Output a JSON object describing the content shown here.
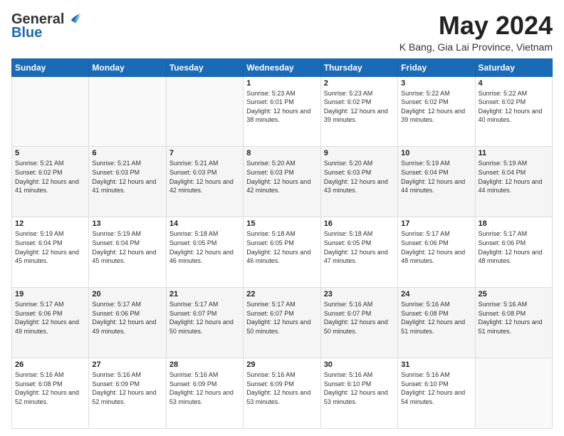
{
  "header": {
    "logo_line1": "General",
    "logo_line2": "Blue",
    "month": "May 2024",
    "location": "K Bang, Gia Lai Province, Vietnam"
  },
  "weekdays": [
    "Sunday",
    "Monday",
    "Tuesday",
    "Wednesday",
    "Thursday",
    "Friday",
    "Saturday"
  ],
  "weeks": [
    [
      {
        "day": "",
        "sunrise": "",
        "sunset": "",
        "daylight": ""
      },
      {
        "day": "",
        "sunrise": "",
        "sunset": "",
        "daylight": ""
      },
      {
        "day": "",
        "sunrise": "",
        "sunset": "",
        "daylight": ""
      },
      {
        "day": "1",
        "sunrise": "5:23 AM",
        "sunset": "6:01 PM",
        "daylight": "12 hours and 38 minutes."
      },
      {
        "day": "2",
        "sunrise": "5:23 AM",
        "sunset": "6:02 PM",
        "daylight": "12 hours and 39 minutes."
      },
      {
        "day": "3",
        "sunrise": "5:22 AM",
        "sunset": "6:02 PM",
        "daylight": "12 hours and 39 minutes."
      },
      {
        "day": "4",
        "sunrise": "5:22 AM",
        "sunset": "6:02 PM",
        "daylight": "12 hours and 40 minutes."
      }
    ],
    [
      {
        "day": "5",
        "sunrise": "5:21 AM",
        "sunset": "6:02 PM",
        "daylight": "12 hours and 41 minutes."
      },
      {
        "day": "6",
        "sunrise": "5:21 AM",
        "sunset": "6:03 PM",
        "daylight": "12 hours and 41 minutes."
      },
      {
        "day": "7",
        "sunrise": "5:21 AM",
        "sunset": "6:03 PM",
        "daylight": "12 hours and 42 minutes."
      },
      {
        "day": "8",
        "sunrise": "5:20 AM",
        "sunset": "6:03 PM",
        "daylight": "12 hours and 42 minutes."
      },
      {
        "day": "9",
        "sunrise": "5:20 AM",
        "sunset": "6:03 PM",
        "daylight": "12 hours and 43 minutes."
      },
      {
        "day": "10",
        "sunrise": "5:19 AM",
        "sunset": "6:04 PM",
        "daylight": "12 hours and 44 minutes."
      },
      {
        "day": "11",
        "sunrise": "5:19 AM",
        "sunset": "6:04 PM",
        "daylight": "12 hours and 44 minutes."
      }
    ],
    [
      {
        "day": "12",
        "sunrise": "5:19 AM",
        "sunset": "6:04 PM",
        "daylight": "12 hours and 45 minutes."
      },
      {
        "day": "13",
        "sunrise": "5:19 AM",
        "sunset": "6:04 PM",
        "daylight": "12 hours and 45 minutes."
      },
      {
        "day": "14",
        "sunrise": "5:18 AM",
        "sunset": "6:05 PM",
        "daylight": "12 hours and 46 minutes."
      },
      {
        "day": "15",
        "sunrise": "5:18 AM",
        "sunset": "6:05 PM",
        "daylight": "12 hours and 46 minutes."
      },
      {
        "day": "16",
        "sunrise": "5:18 AM",
        "sunset": "6:05 PM",
        "daylight": "12 hours and 47 minutes."
      },
      {
        "day": "17",
        "sunrise": "5:17 AM",
        "sunset": "6:06 PM",
        "daylight": "12 hours and 48 minutes."
      },
      {
        "day": "18",
        "sunrise": "5:17 AM",
        "sunset": "6:06 PM",
        "daylight": "12 hours and 48 minutes."
      }
    ],
    [
      {
        "day": "19",
        "sunrise": "5:17 AM",
        "sunset": "6:06 PM",
        "daylight": "12 hours and 49 minutes."
      },
      {
        "day": "20",
        "sunrise": "5:17 AM",
        "sunset": "6:06 PM",
        "daylight": "12 hours and 49 minutes."
      },
      {
        "day": "21",
        "sunrise": "5:17 AM",
        "sunset": "6:07 PM",
        "daylight": "12 hours and 50 minutes."
      },
      {
        "day": "22",
        "sunrise": "5:17 AM",
        "sunset": "6:07 PM",
        "daylight": "12 hours and 50 minutes."
      },
      {
        "day": "23",
        "sunrise": "5:16 AM",
        "sunset": "6:07 PM",
        "daylight": "12 hours and 50 minutes."
      },
      {
        "day": "24",
        "sunrise": "5:16 AM",
        "sunset": "6:08 PM",
        "daylight": "12 hours and 51 minutes."
      },
      {
        "day": "25",
        "sunrise": "5:16 AM",
        "sunset": "6:08 PM",
        "daylight": "12 hours and 51 minutes."
      }
    ],
    [
      {
        "day": "26",
        "sunrise": "5:16 AM",
        "sunset": "6:08 PM",
        "daylight": "12 hours and 52 minutes."
      },
      {
        "day": "27",
        "sunrise": "5:16 AM",
        "sunset": "6:09 PM",
        "daylight": "12 hours and 52 minutes."
      },
      {
        "day": "28",
        "sunrise": "5:16 AM",
        "sunset": "6:09 PM",
        "daylight": "12 hours and 53 minutes."
      },
      {
        "day": "29",
        "sunrise": "5:16 AM",
        "sunset": "6:09 PM",
        "daylight": "12 hours and 53 minutes."
      },
      {
        "day": "30",
        "sunrise": "5:16 AM",
        "sunset": "6:10 PM",
        "daylight": "12 hours and 53 minutes."
      },
      {
        "day": "31",
        "sunrise": "5:16 AM",
        "sunset": "6:10 PM",
        "daylight": "12 hours and 54 minutes."
      },
      {
        "day": "",
        "sunrise": "",
        "sunset": "",
        "daylight": ""
      }
    ]
  ]
}
